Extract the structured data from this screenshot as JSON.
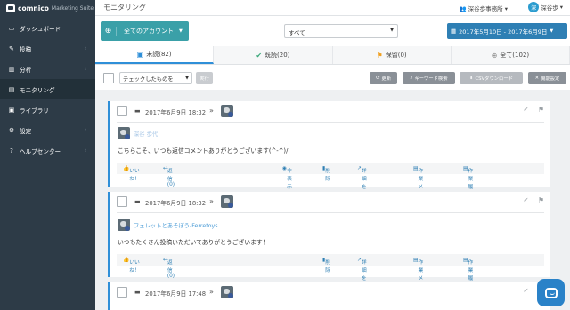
{
  "brand": {
    "name": "comnico",
    "suite": "Marketing Suite"
  },
  "sidebar": {
    "items": [
      {
        "label": "ダッシュボード",
        "icon": "dashboard-icon",
        "chev": false
      },
      {
        "label": "投稿",
        "icon": "pencil-icon",
        "chev": true
      },
      {
        "label": "分析",
        "icon": "chart-icon",
        "chev": true
      },
      {
        "label": "モニタリング",
        "icon": "monitoring-icon",
        "chev": false
      },
      {
        "label": "ライブラリ",
        "icon": "folder-icon",
        "chev": false
      },
      {
        "label": "設定",
        "icon": "gear-icon",
        "chev": true
      },
      {
        "label": "ヘルプセンター",
        "icon": "help-icon",
        "chev": true
      }
    ]
  },
  "header": {
    "title": "モニタリング",
    "org": "深谷歩事務所",
    "user_initial": "深",
    "user": "深谷歩"
  },
  "toolbar": {
    "account_button": "全てのアカウント",
    "filter_value": "すべて",
    "date_range": "2017年5月10日 - 2017年6月9日"
  },
  "tabs": [
    {
      "label": "未読(82)",
      "icon": "inbox-icon"
    },
    {
      "label": "既読(20)",
      "icon": "check-icon"
    },
    {
      "label": "保留(0)",
      "icon": "flag-icon"
    },
    {
      "label": "全て(102)",
      "icon": "globe-icon"
    }
  ],
  "actions": {
    "bulk_select": "チェックしたものを",
    "execute": "実行",
    "refresh": "更新",
    "keyword": "キーワード検索",
    "csv": "CSVダウンロード",
    "settings": "機能設定"
  },
  "posts": [
    {
      "timestamp": "2017年6月9日 18:32",
      "author": "深谷 歩代",
      "author_blurred": true,
      "message": "こちらこそ、いつも返信コメントありがとうございます(^-^)/",
      "actions": [
        "いいね！",
        "返信 (0)",
        "非表示",
        "削除",
        "詳細を表示",
        "作業メモ(0)",
        "作業履歴(0)"
      ]
    },
    {
      "timestamp": "2017年6月9日 18:32",
      "author": "フェレットとあそぼう-Ferretoys",
      "author_blurred": false,
      "message": "いつもたくさん投稿いただいてありがとうございます！",
      "actions": [
        "いいね！",
        "返信 (0)",
        "削除",
        "詳細を表示",
        "作業メモ(0)",
        "作業履歴(0)"
      ]
    },
    {
      "timestamp": "2017年6月9日 17:48"
    }
  ],
  "colors": {
    "sidebar": "#2d3b47",
    "accent": "#2f8fd8",
    "teal": "#3aa0a8"
  }
}
